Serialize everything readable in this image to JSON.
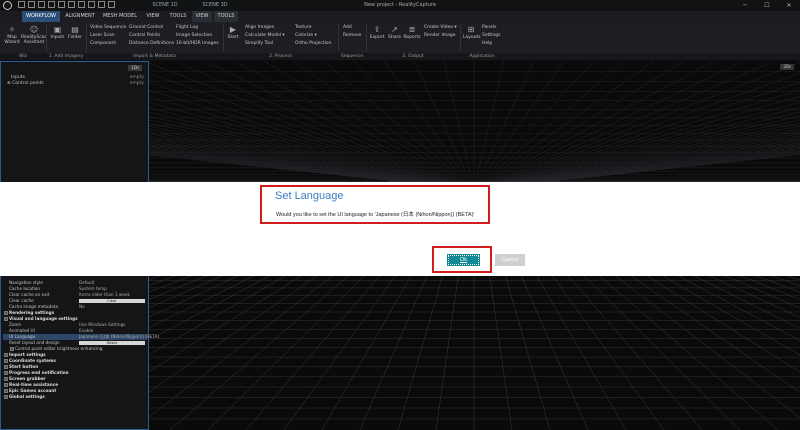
{
  "window": {
    "title": "New project - RealityCapture",
    "scene_tabs": [
      "SCENE 1D",
      "SCENE 3D"
    ],
    "controls": {
      "minimize": "─",
      "maximize": "☐",
      "close": "✕"
    }
  },
  "ribbon": {
    "tabs": [
      {
        "label": "WORKFLOW",
        "active": true
      },
      {
        "label": "ALIGNMENT"
      },
      {
        "label": "MESH MODEL"
      },
      {
        "label": "VIEW"
      },
      {
        "label": "TOOLS"
      },
      {
        "label": "VIEW",
        "context": true
      },
      {
        "label": "TOOLS",
        "context": true
      }
    ],
    "wizards": {
      "quick_wizard": "Map\nWizard",
      "assistant": "RealityScan\nAssistant"
    },
    "add_imagery": {
      "inputs": "Inputs",
      "folder": "Folder"
    },
    "import": {
      "col1": [
        "Video Sequence",
        "Laser Scan",
        "Component"
      ],
      "col2": [
        "Ground Control",
        "Control Points",
        "Distance Definitions"
      ],
      "col3": [
        "Flight Log",
        "Image Selection",
        "16-bit/HDR Images"
      ]
    },
    "process": {
      "start": "Start",
      "col1": [
        "Align Images",
        "Calculate Model ▾",
        "Simplify Tool"
      ],
      "col2": [
        "Texture",
        "Colorize ▾",
        "Ortho Projection"
      ]
    },
    "sequence": {
      "add": "Add",
      "remove": "Remove"
    },
    "output": {
      "export": "Export",
      "share": "Share",
      "reports": "Reports",
      "col": [
        "Create Video ▾",
        "Render Image"
      ]
    },
    "application": {
      "layouts": "Layouts",
      "col": [
        "Panels",
        "Settings",
        "Help"
      ]
    },
    "groups": [
      "Wiz",
      "1. Add imagery",
      "Import & Metadata",
      "2. Process",
      "Sequence",
      "3. Output",
      "Application"
    ]
  },
  "left_panel": {
    "badge": "1Ds",
    "tree": [
      {
        "label": "Inputs",
        "value": "empty"
      },
      {
        "label": "Control points",
        "value": "empty"
      }
    ],
    "settings": [
      {
        "type": "kv",
        "key": "Navigation style",
        "value": "Default"
      },
      {
        "type": "kv",
        "key": "Cache location",
        "value": "System temp"
      },
      {
        "type": "kv",
        "key": "Clear cache on exit",
        "value": "Items older than 1 week"
      },
      {
        "type": "btn",
        "key": "Clear cache",
        "value": "Clear"
      },
      {
        "type": "kv",
        "key": "Cache image metadata",
        "value": "No"
      },
      {
        "type": "hdr",
        "key": "Rendering settings"
      },
      {
        "type": "hdr",
        "key": "Visual and language settings"
      },
      {
        "type": "kv",
        "key": "Zoom",
        "value": "Use Windows Settings"
      },
      {
        "type": "kv",
        "key": "Animated UI",
        "value": "Enable"
      },
      {
        "type": "kv",
        "key": "UI Language",
        "value": "Japanese (日本 (Nihon/Nippon)) (BETA)",
        "selected": true
      },
      {
        "type": "btn",
        "key": "Reset layout and design",
        "value": "Reset"
      },
      {
        "type": "sub",
        "key": "Control point editor brightness enhancing"
      },
      {
        "type": "hdr",
        "key": "Import settings"
      },
      {
        "type": "hdr",
        "key": "Coordinate systems"
      },
      {
        "type": "hdr",
        "key": "Start button"
      },
      {
        "type": "hdr",
        "key": "Progress end notification"
      },
      {
        "type": "hdr",
        "key": "Screen grabber"
      },
      {
        "type": "hdr",
        "key": "Real-time assistance"
      },
      {
        "type": "hdr",
        "key": "Epic Games account"
      },
      {
        "type": "hdr",
        "key": "Global settings"
      }
    ]
  },
  "viewport": {
    "badge": "3Ds"
  },
  "dialog": {
    "title": "Set Language",
    "message": "Would you like to set the UI language to 'Japanese (日本 (Nihon/Nippon)) (BETA)'",
    "ok_label": "Ok",
    "cancel_label": "Cancel"
  },
  "colors": {
    "accent": "#2b4f79",
    "ok_button": "#128a95",
    "highlight": "#d21c1c",
    "dialog_title": "#3a7cc4"
  }
}
